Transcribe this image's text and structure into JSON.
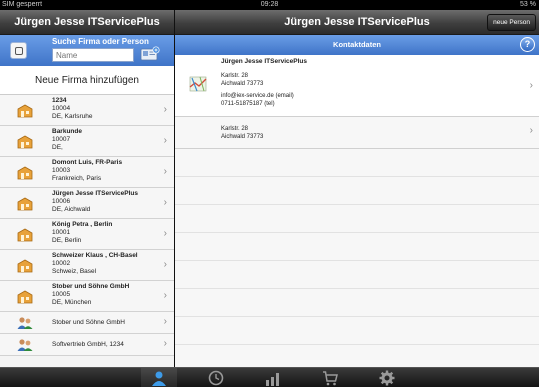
{
  "status_bar": {
    "carrier": "SIM gesperrt",
    "time": "09:28",
    "battery": "53 %"
  },
  "left_header": {
    "title": "Jürgen Jesse ITServicePlus"
  },
  "right_header": {
    "title": "Jürgen Jesse ITServicePlus",
    "new_person_label": "neue Person"
  },
  "search": {
    "title": "Suche Firma oder Person",
    "placeholder": "Name",
    "home_icon": "home-icon",
    "card_icon": "business-card-icon"
  },
  "add_company": {
    "label": "Neue Firma hinzufügen"
  },
  "companies": [
    {
      "name": "1234",
      "line1": "10004",
      "line2": "DE, Karlsruhe",
      "icon": "company-icon"
    },
    {
      "name": "Barkunde",
      "line1": "10007",
      "line2": "DE,",
      "icon": "company-icon"
    },
    {
      "name": "Domont Luis, FR-Paris",
      "line1": "10003",
      "line2": "Frankreich, Paris",
      "icon": "company-icon"
    },
    {
      "name": "Jürgen Jesse ITServicePlus",
      "line1": "10006",
      "line2": "DE, Aichwald",
      "icon": "company-icon"
    },
    {
      "name": "König Petra , Berlin",
      "line1": "10001",
      "line2": "DE, Berlin",
      "icon": "company-icon"
    },
    {
      "name": "Schweizer Klaus , CH-Basel",
      "line1": "10002",
      "line2": "Schweiz, Basel",
      "icon": "company-icon"
    },
    {
      "name": "Stober und Söhne GmbH",
      "line1": "10005",
      "line2": "DE, München",
      "icon": "company-icon"
    }
  ],
  "persons": [
    {
      "label": "Stober und Söhne GmbH",
      "icon": "person-group-icon"
    },
    {
      "label": "Softvertrieb GmbH, 1234",
      "icon": "person-group-icon"
    }
  ],
  "contact": {
    "header": "Kontaktdaten",
    "name": "Jürgen Jesse ITServicePlus",
    "street": "Karlstr. 28",
    "city": "Aichwald 73773",
    "email": "info@iex-service.de (email)",
    "phone": "0711-51875187 (tel)",
    "address_street": "Karlstr. 28",
    "address_city": "Aichwald 73773"
  },
  "tabs": [
    {
      "icon": "person-icon",
      "active": true
    },
    {
      "icon": "clock-icon",
      "active": false
    },
    {
      "icon": "chart-icon",
      "active": false
    },
    {
      "icon": "cart-icon",
      "active": false
    },
    {
      "icon": "gear-icon",
      "active": false
    }
  ],
  "colors": {
    "accent": "#3f74c8",
    "header_dark": "#2b2b2b",
    "company_icon": "#e8a23a"
  }
}
